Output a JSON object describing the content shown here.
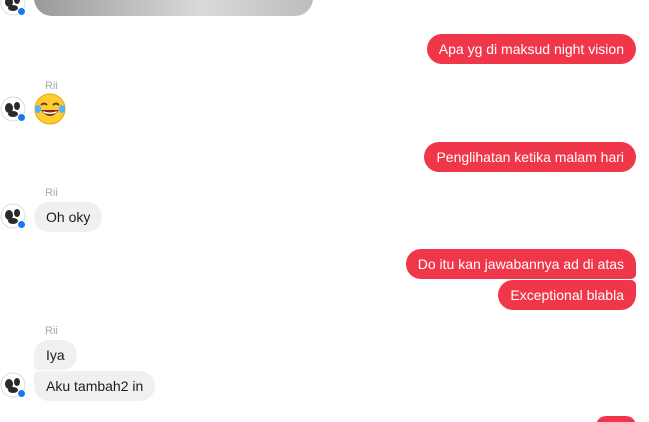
{
  "conversation": {
    "sender_name": "Rii",
    "outgoing": [
      "Apa yg di maksud night vision",
      "Penglihatan ketika malam hari",
      "Do itu kan jawabannya ad di atas",
      "Exceptional blabla"
    ],
    "incoming": [
      "Oh oky",
      "Iya",
      "Aku tambah2 in"
    ]
  },
  "colors": {
    "outgoing_bubble": "#f0374a",
    "incoming_bubble": "#f0f0f0",
    "sender_label": "#a8a8a8",
    "avatar_badge": "#1877f2"
  },
  "icons": {
    "avatar": "avatar-dog-icon",
    "badge": "messenger-badge-icon",
    "emoji": "laughing-tears-emoji-icon"
  }
}
